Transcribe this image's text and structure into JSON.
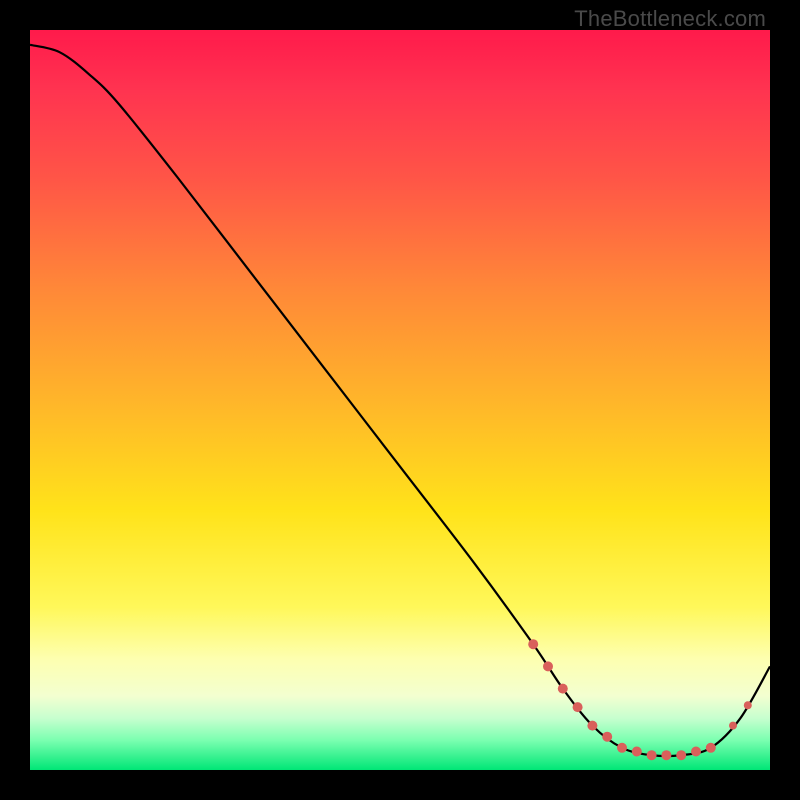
{
  "watermark": "TheBottleneck.com",
  "chart_data": {
    "type": "line",
    "title": "",
    "xlabel": "",
    "ylabel": "",
    "xlim": [
      0,
      100
    ],
    "ylim": [
      0,
      100
    ],
    "grid": false,
    "legend": false,
    "series": [
      {
        "name": "bottleneck-curve",
        "color": "#000000",
        "x": [
          0,
          4,
          8,
          12,
          20,
          30,
          40,
          50,
          60,
          68,
          72,
          76,
          80,
          84,
          88,
          92,
          96,
          100
        ],
        "y": [
          98,
          97,
          94,
          90,
          80,
          67,
          54,
          41,
          28,
          17,
          11,
          6,
          3,
          2,
          2,
          3,
          7,
          14
        ]
      }
    ],
    "annotations": {
      "bottom_marker_range_x": [
        68,
        92
      ],
      "bottom_marker_color": "#d9605b"
    },
    "gradient_stops": [
      {
        "pos": 0.0,
        "color": "#ff1a4b"
      },
      {
        "pos": 0.5,
        "color": "#ffe31a"
      },
      {
        "pos": 0.85,
        "color": "#fdffb0"
      },
      {
        "pos": 1.0,
        "color": "#00e676"
      }
    ]
  }
}
